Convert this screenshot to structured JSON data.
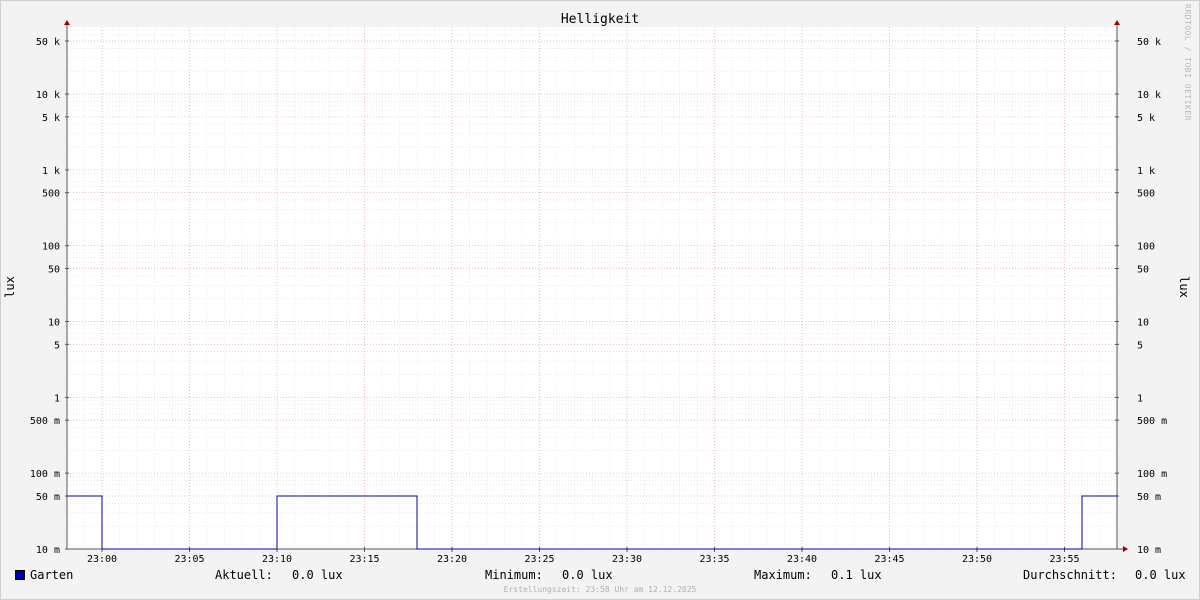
{
  "watermark": "RRDTOOL / TOBI OETIKER",
  "footer": "Erstellungszeit: 23:58 Uhr am 12.12.2025",
  "legend": {
    "series_name": "Garten",
    "series_color": "#0000a8",
    "current_label": "Aktuell:",
    "current_value": "0.0 lux",
    "min_label": "Minimum:",
    "min_value": "0.0 lux",
    "max_label": "Maximum:",
    "max_value": "0.1 lux",
    "avg_label": "Durchschnitt:",
    "avg_value": "0.0 lux"
  },
  "chart_data": {
    "type": "line",
    "title": "Helligkeit",
    "ylabel": "lux",
    "yscale": "log",
    "ylim": [
      0.01,
      70000
    ],
    "y_ticks": [
      {
        "value": 0.01,
        "label": "10 m"
      },
      {
        "value": 0.05,
        "label": "50 m"
      },
      {
        "value": 0.1,
        "label": "100 m"
      },
      {
        "value": 0.5,
        "label": "500 m"
      },
      {
        "value": 1,
        "label": "1"
      },
      {
        "value": 5,
        "label": "5"
      },
      {
        "value": 10,
        "label": "10"
      },
      {
        "value": 50,
        "label": "50"
      },
      {
        "value": 100,
        "label": "100"
      },
      {
        "value": 500,
        "label": "500"
      },
      {
        "value": 1000,
        "label": "1 k"
      },
      {
        "value": 5000,
        "label": "5 k"
      },
      {
        "value": 10000,
        "label": "10 k"
      },
      {
        "value": 50000,
        "label": "50 k"
      }
    ],
    "x_ticks": [
      "23:00",
      "23:05",
      "23:10",
      "23:15",
      "23:20",
      "23:25",
      "23:30",
      "23:35",
      "23:40",
      "23:45",
      "23:50",
      "23:55"
    ],
    "xlim": [
      "22:58",
      "23:58"
    ],
    "grid": true,
    "series": [
      {
        "name": "Garten",
        "color": "#0000a8",
        "points": [
          [
            "22:58",
            0.05
          ],
          [
            "23:00",
            0.05
          ],
          [
            "23:00",
            0.01
          ],
          [
            "23:10",
            0.01
          ],
          [
            "23:10",
            0.05
          ],
          [
            "23:18",
            0.05
          ],
          [
            "23:18",
            0.01
          ],
          [
            "23:56",
            0.01
          ],
          [
            "23:56",
            0.05
          ],
          [
            "23:58",
            0.05
          ]
        ]
      }
    ]
  }
}
